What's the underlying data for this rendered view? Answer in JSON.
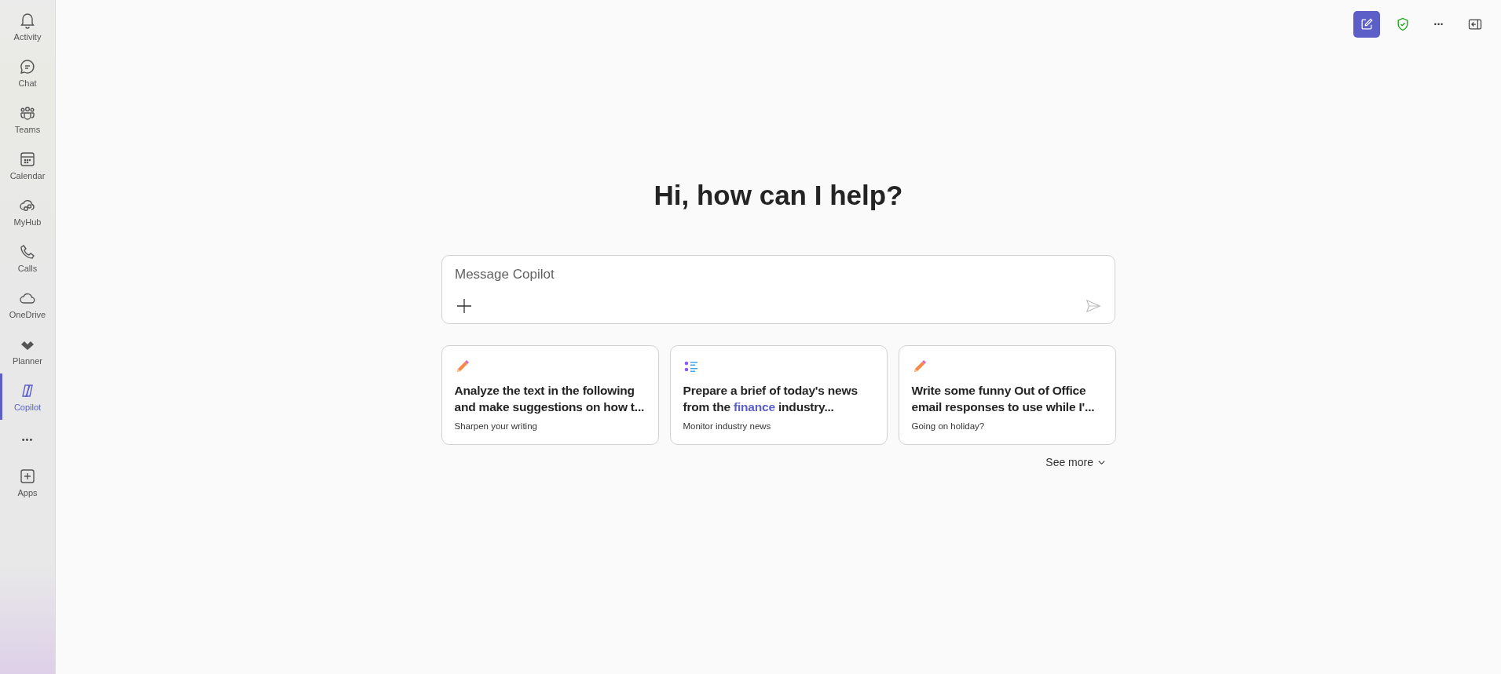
{
  "sidebar": {
    "items": [
      {
        "label": "Activity",
        "selected": false
      },
      {
        "label": "Chat",
        "selected": false
      },
      {
        "label": "Teams",
        "selected": false
      },
      {
        "label": "Calendar",
        "selected": false
      },
      {
        "label": "MyHub",
        "selected": false
      },
      {
        "label": "Calls",
        "selected": false
      },
      {
        "label": "OneDrive",
        "selected": false
      },
      {
        "label": "Planner",
        "selected": false
      },
      {
        "label": "Copilot",
        "selected": true
      }
    ],
    "more": "•••",
    "apps": {
      "label": "Apps"
    }
  },
  "toolbar": {
    "more": "•••"
  },
  "heading": "Hi, how can I help?",
  "composer": {
    "placeholder": "Message Copilot"
  },
  "prompts": [
    {
      "kind": "pencil",
      "title": "Analyze the text in the following and make suggestions on how t...",
      "subtitle": "Sharpen your writing"
    },
    {
      "kind": "list",
      "title": "Prepare a brief of today's news from the ",
      "link": "finance",
      "title_after": " industry...",
      "subtitle": "Monitor industry news"
    },
    {
      "kind": "pencil",
      "title": "Write some funny Out of Office email responses to use while I'...",
      "subtitle": "Going on holiday?"
    }
  ],
  "see_more": "See more"
}
